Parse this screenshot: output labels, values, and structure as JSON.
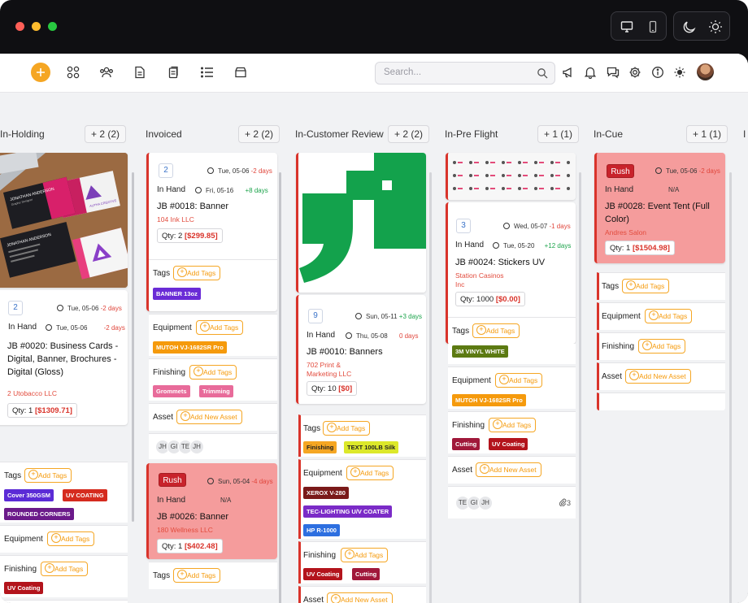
{
  "toolbar": {
    "search_placeholder": "Search..."
  },
  "columns": [
    {
      "name": "In-Holding",
      "count": "+ 2 (2)"
    },
    {
      "name": "Invoiced",
      "count": "+ 2 (2)"
    },
    {
      "name": "In-Customer Review",
      "count": "+ 2 (2)"
    },
    {
      "name": "In-Pre Flight",
      "count": "+ 1 (1)"
    },
    {
      "name": "In-Cue",
      "count": "+ 1 (1)"
    },
    {
      "name": "I",
      "count": ""
    }
  ],
  "labels": {
    "in_hand": "In Hand",
    "tags": "Tags",
    "equipment": "Equipment",
    "finishing": "Finishing",
    "asset": "Asset",
    "add_tags": "Add Tags",
    "add_asset": "Add New Asset",
    "rush": "Rush",
    "na": "N/A"
  },
  "cards": {
    "c0020": {
      "num": "2",
      "due_date": "Tue, 05-06",
      "due_rel": "-2 days",
      "hand_date": "Tue, 05-06",
      "hand_rel": "-2 days",
      "title": "JB #0020: Business Cards - Digital, Banner, Brochures - Digital (Gloss)",
      "company": "2 Utobacco LLC",
      "qty_label": "Qty: 1",
      "qty_price": "[$1309.71]",
      "tags": [
        "Cover 350GSM",
        "UV COATING",
        "ROUNDED CORNERS"
      ],
      "finishing": [
        "UV Coating"
      ]
    },
    "c0018": {
      "num": "2",
      "due_date": "Tue, 05-06",
      "due_rel": "-2 days",
      "hand_date": "Fri, 05-16",
      "hand_rel": "+8 days",
      "title": "JB #0018: Banner",
      "company": "104 Ink LLC",
      "qty_label": "Qty: 2",
      "qty_price": "[$299.85]",
      "tags": [
        "BANNER 13oz"
      ],
      "equipment": [
        "MUTOH VJ-1682SR Pro"
      ],
      "finishing": [
        "Grommets",
        "Trimming"
      ],
      "avatars": [
        "JH",
        "GI",
        "TE",
        "JH"
      ]
    },
    "c0026": {
      "due_date": "Sun, 05-04",
      "due_rel": "-4 days",
      "title": "JB #0026: Banner",
      "company": "180 Wellness LLC",
      "qty_label": "Qty: 1",
      "qty_price": "[$402.48]"
    },
    "c0010": {
      "num": "9",
      "due_date": "Sun, 05-11",
      "due_rel": "+3 days",
      "hand_date": "Thu, 05-08",
      "hand_rel": "0 days",
      "title": "JB #0010: Banners",
      "company": "702 Print & Marketing LLC",
      "qty_label": "Qty: 10",
      "qty_price": "[$0]",
      "tags": [
        "Finishing",
        "TEXT 100LB Silk"
      ],
      "equipment": [
        "XEROX V-280",
        "TEC-LIGHTING U/V COATER",
        "HP R-1000"
      ],
      "finishing": [
        "UV Coating",
        "Cutting"
      ]
    },
    "c0024": {
      "num": "3",
      "due_date": "Wed, 05-07",
      "due_rel": "-1 days",
      "hand_date": "Tue, 05-20",
      "hand_rel": "+12 days",
      "title": "JB #0024: Stickers UV",
      "company": "Station Casinos Inc",
      "qty_label": "Qty: 1000",
      "qty_price": "[$0.00]",
      "tags": [
        "3M VINYL WHITE"
      ],
      "equipment": [
        "MUTOH VJ-1682SR Pro"
      ],
      "finishing": [
        "Cutting",
        "UV Coating"
      ],
      "avatars": [
        "TE",
        "GI",
        "JH"
      ],
      "attachments": "3"
    },
    "c0028": {
      "due_date": "Tue, 05-06",
      "due_rel": "-2 days",
      "title": "JB #0028: Event Tent (Full Color)",
      "company": "Andres Salon",
      "qty_label": "Qty: 1",
      "qty_price": "[$1504.98]"
    }
  },
  "business_card": {
    "name_text": "JONATHAN ANDERSON",
    "subtitle": "Graphic Designer",
    "brand": "ALPHA CREATIVE"
  },
  "colors": {
    "accent": "#f5a623",
    "rush": "#c8232b",
    "pink": "#f59c9c",
    "green_logo": "#13a24c"
  }
}
